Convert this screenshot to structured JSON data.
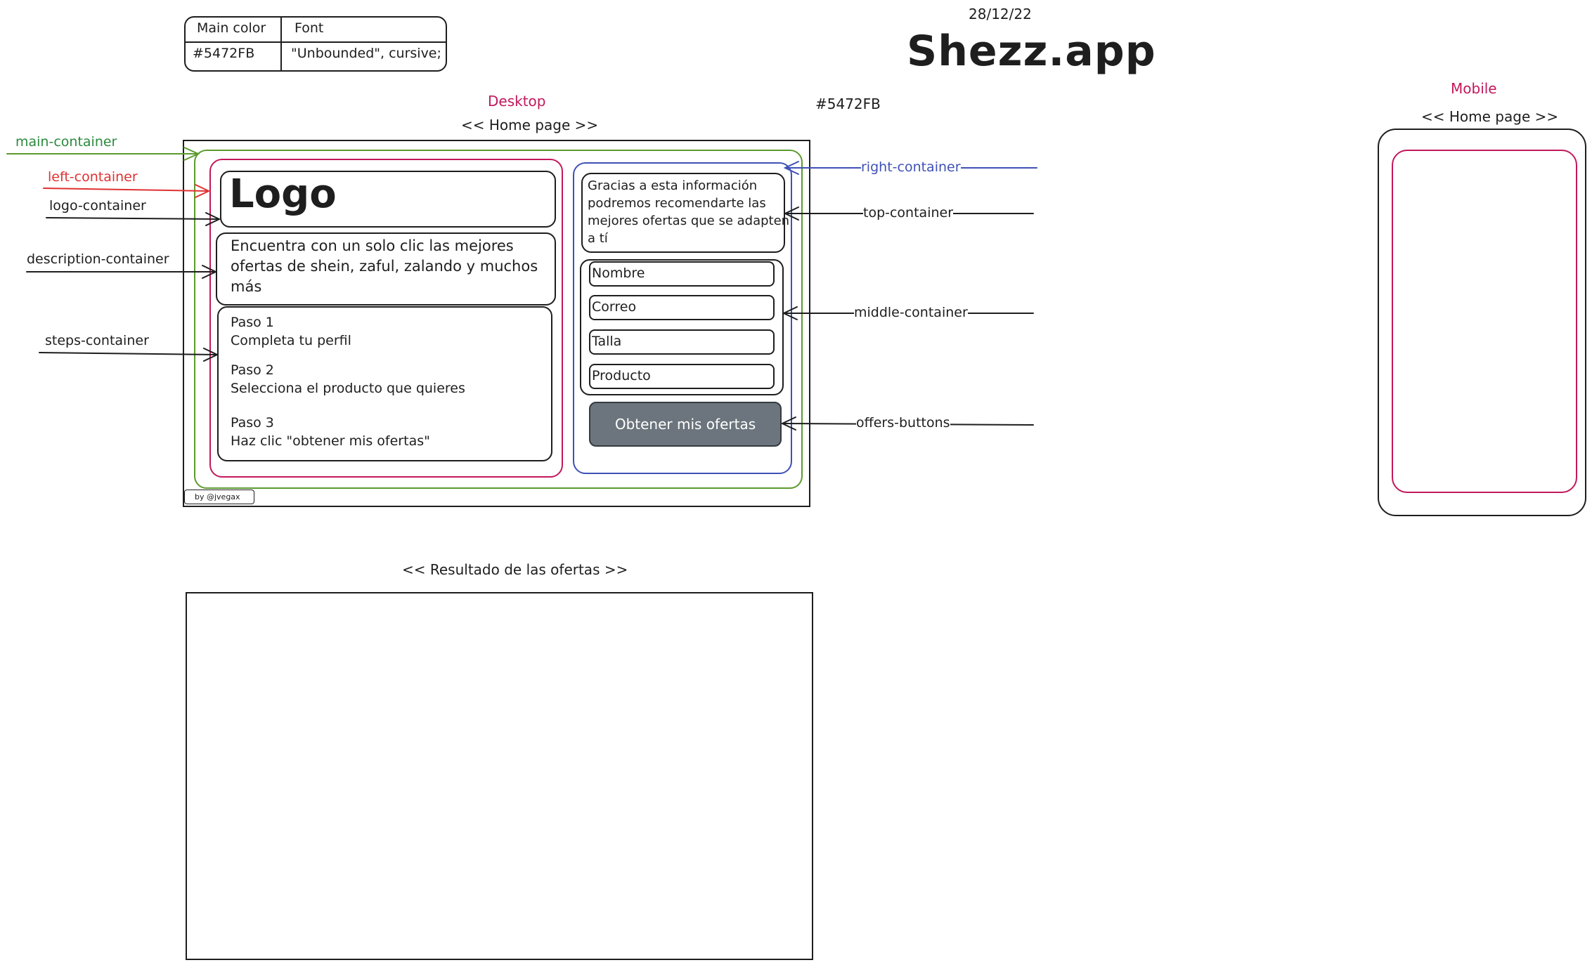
{
  "legend": {
    "header_color": "Main color",
    "header_font": "Font",
    "value_color": "#5472FB",
    "value_font": "\"Unbounded\", cursive;"
  },
  "header": {
    "date": "28/12/22",
    "title": "Shezz.app",
    "color_hex_label": "#5472FB"
  },
  "desktop": {
    "section_label": "Desktop",
    "page_label": "<< Home page >>",
    "logo_text": "Logo",
    "description": "Encuentra con un solo clic las mejores ofertas de shein, zaful, zalando y muchos más",
    "steps": [
      {
        "title": "Paso 1",
        "text": "Completa tu perfil"
      },
      {
        "title": "Paso 2",
        "text": "Selecciona el producto que quieres"
      },
      {
        "title": "Paso 3",
        "text": "Haz clic \"obtener mis ofertas\""
      }
    ],
    "top_text": "Gracias a esta información podremos recomendarte las mejores ofertas que se adapten a tí",
    "fields": [
      "Nombre",
      "Correo",
      "Talla",
      "Producto"
    ],
    "offers_button": "Obtener mis ofertas",
    "credit": "by @jvegax"
  },
  "annotations": {
    "main_container": "main-container",
    "left_container": "left-container",
    "logo_container": "logo-container",
    "description_container": "description-container",
    "steps_container": "steps-container",
    "right_container": "right-container",
    "top_container": "top-container",
    "middle_container": "middle-container",
    "offers_buttons": "offers-buttons"
  },
  "mobile": {
    "section_label": "Mobile",
    "page_label": "<< Home page >>"
  },
  "results": {
    "page_label": "<< Resultado de las ofertas >>"
  },
  "colors": {
    "main_container": "#5b9b2d",
    "left_container": "#c2185b",
    "right_container": "#3f51b5",
    "button_bg": "#6c757d"
  }
}
